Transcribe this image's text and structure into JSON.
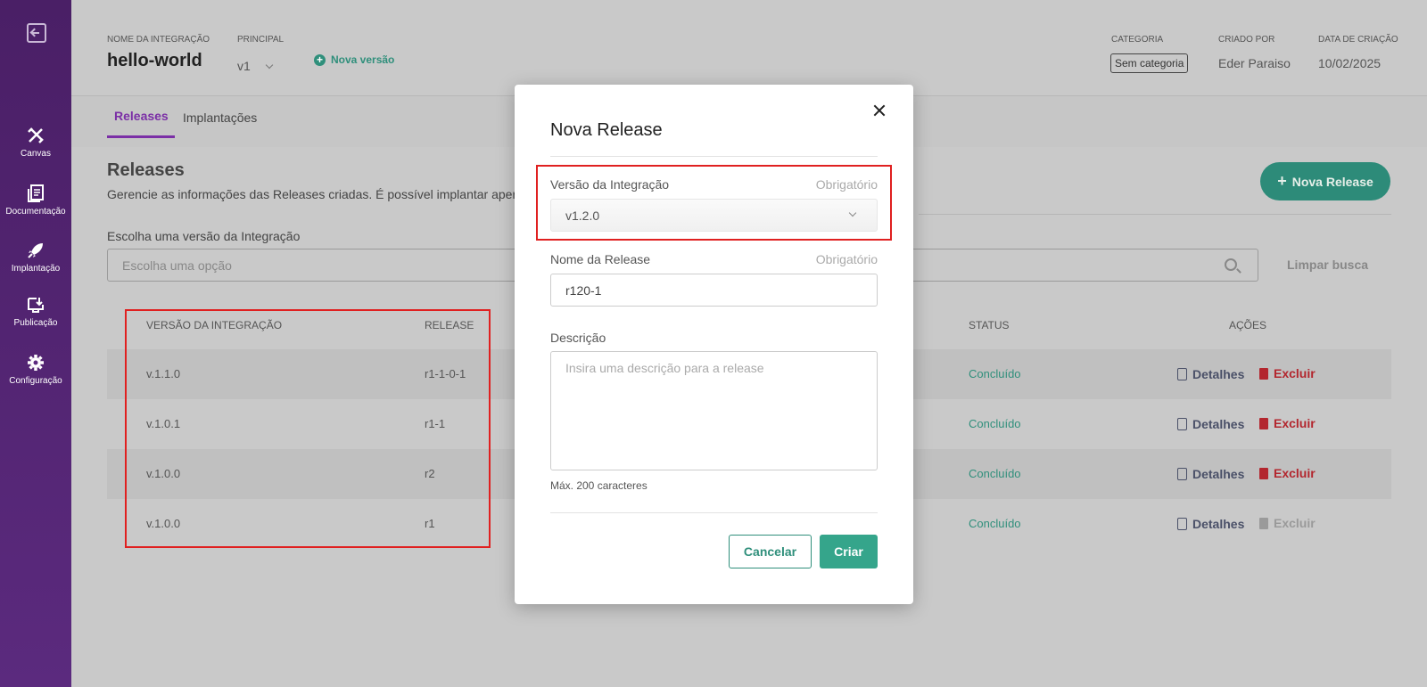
{
  "sidebar": {
    "items": [
      {
        "label": "Canvas",
        "icon": "canvas-icon"
      },
      {
        "label": "Documentação",
        "icon": "documentation-icon"
      },
      {
        "label": "Implantação",
        "icon": "rocket-icon"
      },
      {
        "label": "Publicação",
        "icon": "publish-icon"
      },
      {
        "label": "Configuração",
        "icon": "gear-icon"
      }
    ]
  },
  "header": {
    "name_label": "NOME DA INTEGRAÇÃO",
    "name_value": "hello-world",
    "principal_label": "PRINCIPAL",
    "principal_value": "v1",
    "new_version": "Nova versão",
    "category_label": "CATEGORIA",
    "category_value": "Sem categoria",
    "created_by_label": "CRIADO POR",
    "created_by_value": "Eder Paraiso",
    "created_at_label": "DATA DE CRIAÇÃO",
    "created_at_value": "10/02/2025"
  },
  "tabs": [
    {
      "label": "Releases",
      "active": true
    },
    {
      "label": "Implantações",
      "active": false
    }
  ],
  "main": {
    "title": "Releases",
    "description": "Gerencie as informações das Releases criadas. É possível implantar aper",
    "new_release_button": "Nova Release",
    "filter_label": "Escolha uma versão da Integração",
    "filter_placeholder": "Escolha uma opção",
    "clear_search": "Limpar busca"
  },
  "table": {
    "headers": [
      "VERSÃO DA INTEGRAÇÃO",
      "RELEASE",
      "STATUS",
      "AÇÕES"
    ],
    "rows": [
      {
        "version": "v.1.1.0",
        "release": "r1-1-0-1",
        "status": "Concluído",
        "details": "Detalhes",
        "delete": "Excluir",
        "delete_enabled": true
      },
      {
        "version": "v.1.0.1",
        "release": "r1-1",
        "status": "Concluído",
        "details": "Detalhes",
        "delete": "Excluir",
        "delete_enabled": true
      },
      {
        "version": "v.1.0.0",
        "release": "r2",
        "status": "Concluído",
        "details": "Detalhes",
        "delete": "Excluir",
        "delete_enabled": true
      },
      {
        "version": "v.1.0.0",
        "release": "r1",
        "status": "Concluído",
        "details": "Detalhes",
        "delete": "Excluir",
        "delete_enabled": false
      }
    ]
  },
  "modal": {
    "title": "Nova Release",
    "version_label": "Versão da Integração",
    "version_required": "Obrigatório",
    "version_value": "v1.2.0",
    "name_label": "Nome da Release",
    "name_required": "Obrigatório",
    "name_value": "r120-1",
    "description_label": "Descrição",
    "description_placeholder": "Insira uma descrição para a release",
    "hint": "Máx. 200 caracteres",
    "cancel": "Cancelar",
    "create": "Criar"
  },
  "colors": {
    "sidebar": "#5b2a7e",
    "accent": "#7b2fa6",
    "primary": "#35a58b",
    "danger": "#b3262e",
    "highlight": "#e02020"
  }
}
